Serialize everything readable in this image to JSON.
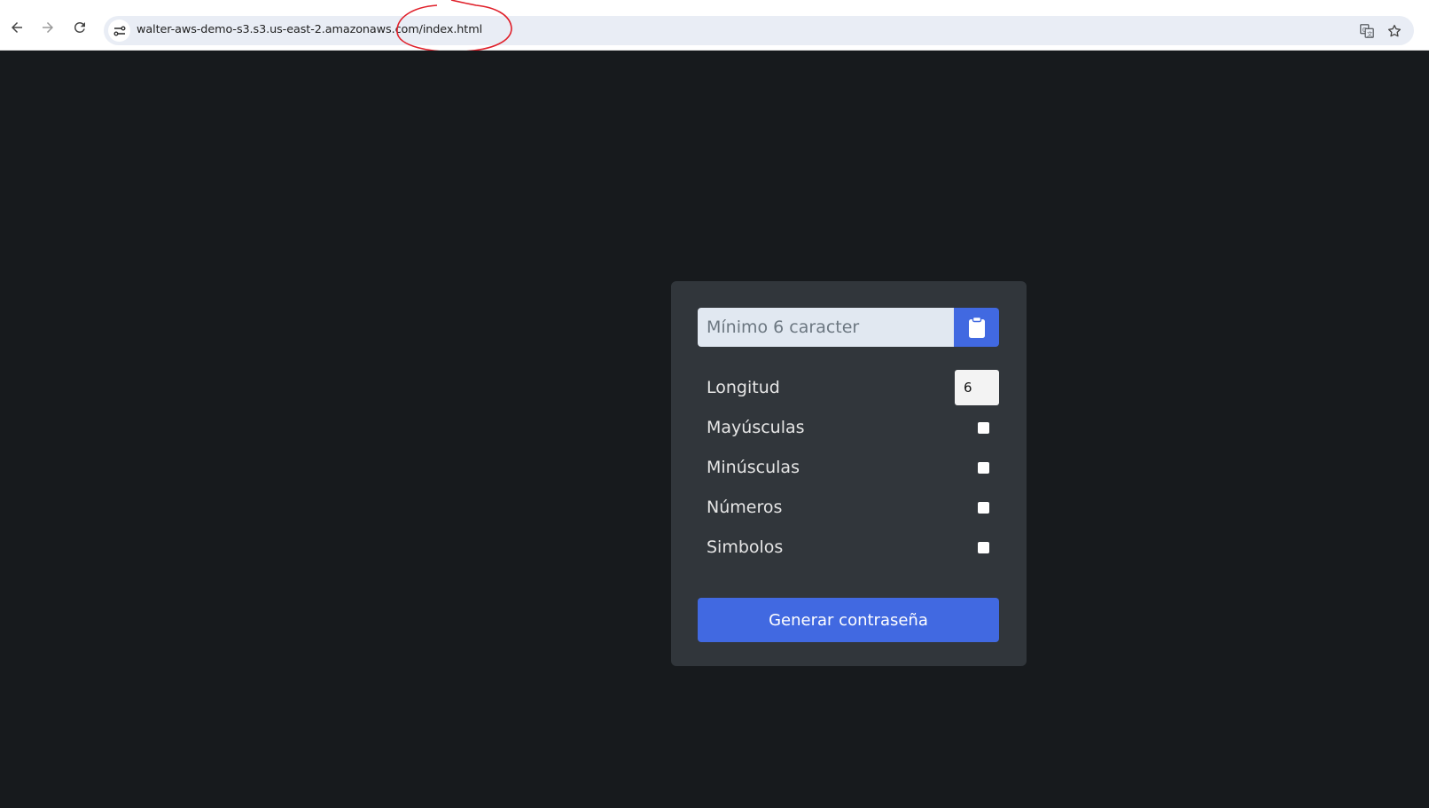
{
  "browser": {
    "url": "walter-aws-demo-s3.s3.us-east-2.amazonaws.com/index.html",
    "back_icon": "back-arrow-icon",
    "forward_icon": "forward-arrow-icon",
    "reload_icon": "reload-icon",
    "site_info_icon": "tune-icon",
    "translate_icon": "translate-icon",
    "bookmark_icon": "star-icon",
    "annotation_color": "#e0202a"
  },
  "generator": {
    "password_placeholder": "Mínimo 6 caracter",
    "password_value": "",
    "copy_icon": "clipboard-icon",
    "length_label": "Longitud",
    "length_value": "6",
    "options": [
      {
        "label": "Mayúsculas",
        "checked": false
      },
      {
        "label": "Minúsculas",
        "checked": false
      },
      {
        "label": "Números",
        "checked": false
      },
      {
        "label": "Simbolos",
        "checked": false
      }
    ],
    "generate_label": "Generar contraseña"
  },
  "colors": {
    "page_bg": "#171a1d",
    "card_bg": "#31363b",
    "accent": "#4169e1",
    "input_bg": "#e1e8f1"
  }
}
